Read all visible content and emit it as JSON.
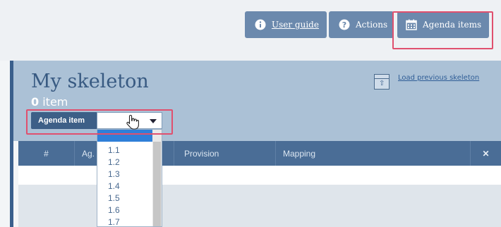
{
  "toolbar": {
    "user_guide": "User guide",
    "actions": "Actions",
    "agenda_items": "Agenda items"
  },
  "header": {
    "title": "My skeleton",
    "count_number": "0",
    "count_unit": " item",
    "load_previous": "Load previous skeleton"
  },
  "selector": {
    "label": "Agenda item",
    "value": ""
  },
  "table": {
    "col_num": "#",
    "col_ag": "Ag.",
    "col_provision": "Provision",
    "col_mapping": "Mapping",
    "col_remove": "✕"
  },
  "dropdown": {
    "items": [
      "1.1",
      "1.2",
      "1.3",
      "1.4",
      "1.5",
      "1.6",
      "1.7"
    ]
  },
  "colors": {
    "button_bg": "#6b89ad",
    "band_bg": "#abc1d6",
    "header_bg": "#4a6d96",
    "highlight": "#e0506e",
    "dropdown_selected": "#2f7fd8"
  },
  "icons": {
    "user_guide": "info-icon",
    "actions": "help-icon",
    "agenda_items": "calendar-icon",
    "load_previous": "upload-icon",
    "cursor": "hand-pointer-icon"
  }
}
